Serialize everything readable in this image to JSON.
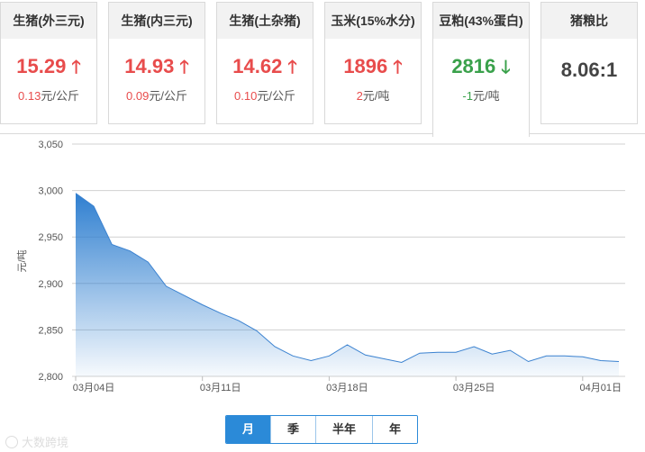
{
  "cards": [
    {
      "title": "生猪(外三元)",
      "price": "15.29",
      "change": "0.13",
      "unit": "元/公斤",
      "trend": "up",
      "arrow": "🡑"
    },
    {
      "title": "生猪(内三元)",
      "price": "14.93",
      "change": "0.09",
      "unit": "元/公斤",
      "trend": "up",
      "arrow": "🡑"
    },
    {
      "title": "生猪(土杂猪)",
      "price": "14.62",
      "change": "0.10",
      "unit": "元/公斤",
      "trend": "up",
      "arrow": "🡑"
    },
    {
      "title": "玉米(15%水分)",
      "price": "1896",
      "change": "2",
      "unit": "元/吨",
      "trend": "up",
      "arrow": "🡑"
    },
    {
      "title": "豆粕(43%蛋白)",
      "price": "2816",
      "change": "-1",
      "unit": "元/吨",
      "trend": "down",
      "arrow": "🡓"
    },
    {
      "title": "猪粮比",
      "price": "8.06:1",
      "change": "",
      "unit": "",
      "trend": "none",
      "arrow": ""
    }
  ],
  "colors": {
    "up": "#e84c4c",
    "down": "#3aa14b",
    "accent": "#2b8ad8",
    "line": "#3b82d0"
  },
  "chart_data": {
    "type": "area",
    "ylabel": "元/吨",
    "ylim": [
      2800,
      3050
    ],
    "yticks": [
      "2,800",
      "2,850",
      "2,900",
      "2,950",
      "3,000",
      "3,050"
    ],
    "xticks": [
      "03月04日",
      "03月11日",
      "03月18日",
      "03月25日",
      "04月01日"
    ],
    "grid": true,
    "series": [
      {
        "values": [
          2997,
          2983,
          2942,
          2935,
          2923,
          2897,
          2887,
          2877,
          2868,
          2860,
          2849,
          2832,
          2822,
          2817,
          2822,
          2834,
          2823,
          2819,
          2815,
          2825,
          2826,
          2826,
          2832,
          2824,
          2828,
          2816,
          2822,
          2822,
          2821,
          2817,
          2816
        ]
      }
    ]
  },
  "tabs": [
    {
      "label": "月",
      "active": true
    },
    {
      "label": "季",
      "active": false
    },
    {
      "label": "半年",
      "active": false
    },
    {
      "label": "年",
      "active": false
    }
  ],
  "watermark": "大数跨境"
}
